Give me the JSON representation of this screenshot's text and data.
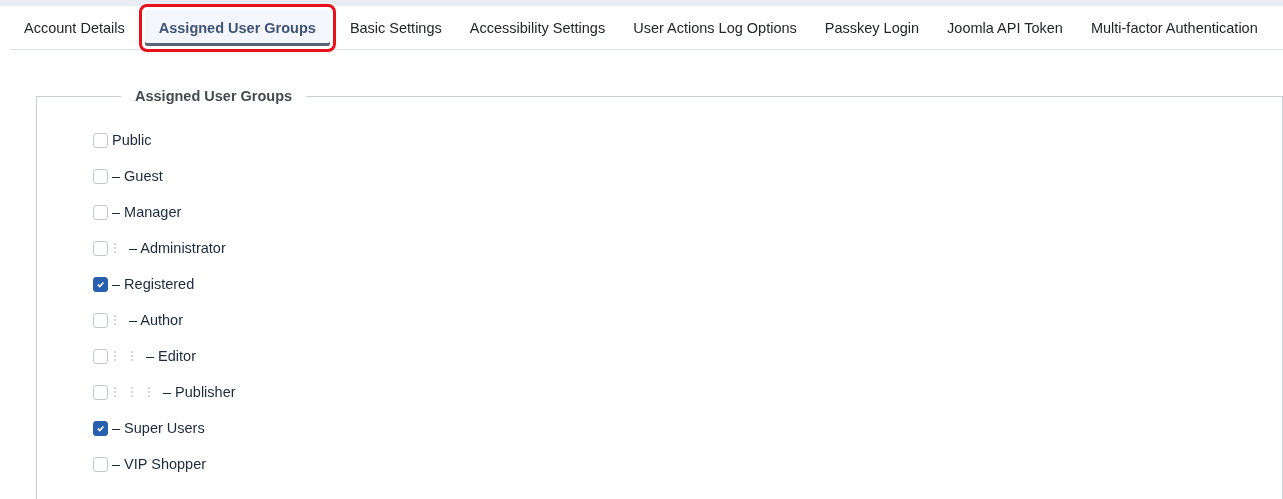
{
  "tabs": [
    {
      "label": "Account Details",
      "selected": false,
      "highlighted": false
    },
    {
      "label": "Assigned User Groups",
      "selected": true,
      "highlighted": true
    },
    {
      "label": "Basic Settings",
      "selected": false,
      "highlighted": false
    },
    {
      "label": "Accessibility Settings",
      "selected": false,
      "highlighted": false
    },
    {
      "label": "User Actions Log Options",
      "selected": false,
      "highlighted": false
    },
    {
      "label": "Passkey Login",
      "selected": false,
      "highlighted": false
    },
    {
      "label": "Joomla API Token",
      "selected": false,
      "highlighted": false
    },
    {
      "label": "Multi-factor Authentication",
      "selected": false,
      "highlighted": false
    }
  ],
  "fieldset": {
    "legend": "Assigned User Groups",
    "groups": [
      {
        "label": "Public",
        "checked": false,
        "children": [
          {
            "label": "– Guest",
            "checked": false
          },
          {
            "label": "– Manager",
            "checked": false,
            "children": [
              {
                "label": "– Administrator",
                "checked": false
              }
            ]
          },
          {
            "label": "– Registered",
            "checked": true,
            "children": [
              {
                "label": "– Author",
                "checked": false,
                "children": [
                  {
                    "label": "– Editor",
                    "checked": false,
                    "children": [
                      {
                        "label": "– Publisher",
                        "checked": false
                      }
                    ]
                  }
                ]
              }
            ]
          },
          {
            "label": "– Super Users",
            "checked": true
          },
          {
            "label": "– VIP Shopper",
            "checked": false
          }
        ]
      }
    ]
  }
}
